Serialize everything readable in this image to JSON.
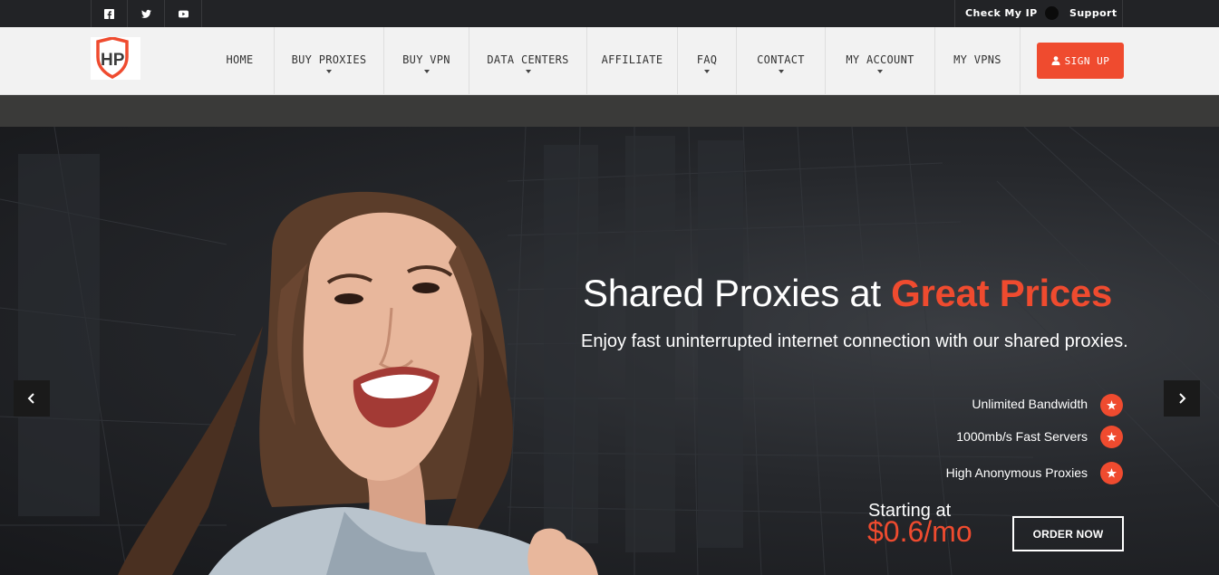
{
  "topbar": {
    "social": [
      "facebook-icon",
      "twitter-icon",
      "youtube-icon"
    ],
    "check_ip": "Check My IP",
    "support": "Support"
  },
  "logo": {
    "text": "HP"
  },
  "nav": {
    "items": [
      {
        "label": "HOME",
        "dropdown": false
      },
      {
        "label": "BUY PROXIES",
        "dropdown": true
      },
      {
        "label": "BUY VPN",
        "dropdown": true
      },
      {
        "label": "DATA CENTERS",
        "dropdown": true
      },
      {
        "label": "AFFILIATE",
        "dropdown": false
      },
      {
        "label": "FAQ",
        "dropdown": true
      },
      {
        "label": "CONTACT",
        "dropdown": true
      },
      {
        "label": "MY ACCOUNT",
        "dropdown": true
      },
      {
        "label": "MY VPNS",
        "dropdown": false
      }
    ],
    "signup": "SIGN UP"
  },
  "hero": {
    "headline_main": "Shared Proxies at ",
    "headline_accent": "Great Prices",
    "subline": "Enjoy fast uninterrupted internet connection with our shared proxies.",
    "features": [
      "Unlimited Bandwidth",
      "1000mb/s Fast Servers",
      "High Anonymous Proxies"
    ],
    "starting_label": "Starting at",
    "price": "$0.6/mo",
    "cta": "ORDER NOW"
  },
  "colors": {
    "accent": "#ef4b2f",
    "topbar": "#222326",
    "nav": "#f2f2f2"
  }
}
